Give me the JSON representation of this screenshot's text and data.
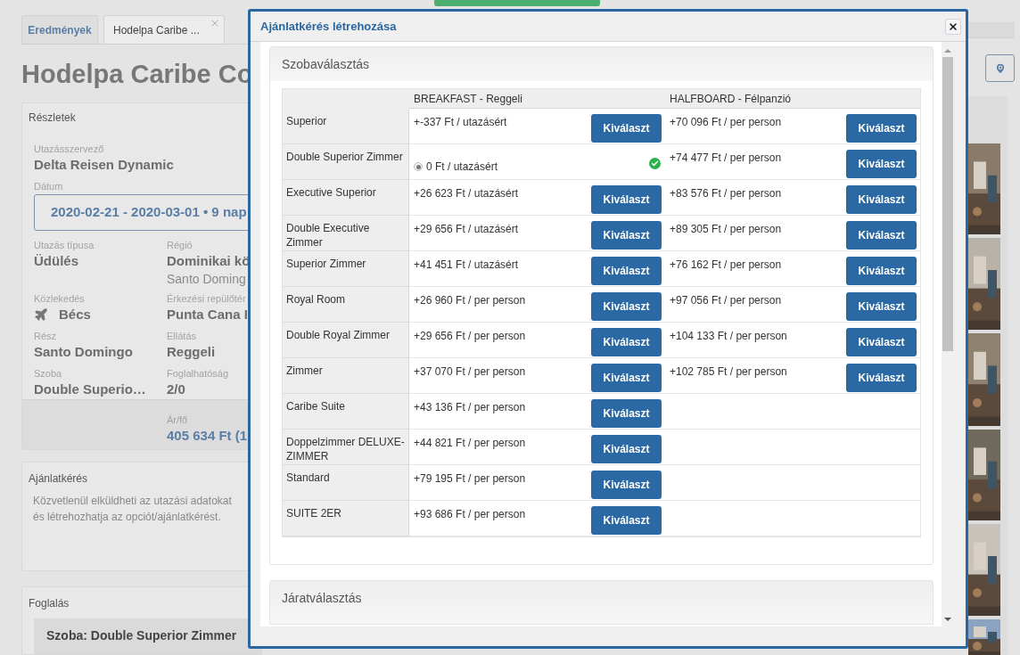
{
  "tabs": [
    {
      "label": "Eredmények",
      "selected": false
    },
    {
      "label": "Hodelpa Caribe ...",
      "selected": true
    }
  ],
  "page_title": "Hodelpa Caribe Co",
  "details": {
    "title": "Részletek",
    "fields": [
      {
        "kind": "plain",
        "label": "Utazásszervező",
        "value": "Delta Reisen Dynamic"
      },
      {
        "kind": "date",
        "label": "Dátum",
        "value": "2020-02-21 - 2020-03-01 • 9 nap"
      }
    ],
    "grid": [
      {
        "kind": "plain",
        "label": "Utazás típusa",
        "value": "Üdülés"
      },
      {
        "kind": "plain",
        "label": "Régió",
        "value": "Dominikai kö",
        "sub": "Santo Doming"
      },
      {
        "kind": "transport",
        "label": "Közlekedés",
        "value": "Bécs"
      },
      {
        "kind": "plain",
        "label": "Érkezési repülőtér",
        "value": "Punta Cana I"
      },
      {
        "kind": "plain",
        "label": "Rész",
        "value": "Santo Domingo"
      },
      {
        "kind": "plain",
        "label": "Ellátás",
        "value": "Reggeli"
      },
      {
        "kind": "plain",
        "label": "Szoba",
        "value": "Double Superio…"
      },
      {
        "kind": "plain",
        "label": "Foglalhatóság",
        "value": "2/0"
      }
    ],
    "price": {
      "label": "Ár/fő",
      "value": "405 634 Ft (1"
    }
  },
  "offer_request": {
    "title": "Ajánlatkérés",
    "lines": [
      "Közvetlenül elküldheti az utazási adatokat",
      "és létrehozhatja az opciót/ajánlatkérést."
    ]
  },
  "booking": {
    "title": "Foglalás",
    "room": "Szoba: Double Superior Zimmer"
  },
  "modal": {
    "title": "Ajánlatkérés létrehozása",
    "room_section": {
      "title": "Szobaválasztás",
      "columns": [
        "BREAKFAST - Reggeli",
        "HALFBOARD - Félpanzió"
      ],
      "rows": [
        {
          "name": "Superior",
          "cells": [
            {
              "kind": "offer",
              "price": "+-337 Ft / utazásért",
              "selected": false,
              "button": "Kiválaszt"
            },
            {
              "kind": "offer",
              "price": "+70 096 Ft / per person",
              "selected": false,
              "button": "Kiválaszt"
            }
          ]
        },
        {
          "name": "Double Superior Zimmer",
          "cells": [
            {
              "kind": "offer",
              "price": "0 Ft / utazásért",
              "selected": true
            },
            {
              "kind": "offer",
              "price": "+74 477 Ft / per person",
              "selected": false,
              "button": "Kiválaszt"
            }
          ]
        },
        {
          "name": "Executive Superior",
          "cells": [
            {
              "kind": "offer",
              "price": "+26 623 Ft / utazásért",
              "selected": false,
              "button": "Kiválaszt"
            },
            {
              "kind": "offer",
              "price": "+83 576 Ft / per person",
              "selected": false,
              "button": "Kiválaszt"
            }
          ]
        },
        {
          "name": "Double Executive Zimmer",
          "cells": [
            {
              "kind": "offer",
              "price": "+29 656 Ft / utazásért",
              "selected": false,
              "button": "Kiválaszt"
            },
            {
              "kind": "offer",
              "price": "+89 305 Ft / per person",
              "selected": false,
              "button": "Kiválaszt"
            }
          ]
        },
        {
          "name": "Superior Zimmer",
          "cells": [
            {
              "kind": "offer",
              "price": "+41 451 Ft / utazásért",
              "selected": false,
              "button": "Kiválaszt"
            },
            {
              "kind": "offer",
              "price": "+76 162 Ft / per person",
              "selected": false,
              "button": "Kiválaszt"
            }
          ]
        },
        {
          "name": "Royal Room",
          "cells": [
            {
              "kind": "offer",
              "price": "+26 960 Ft / per person",
              "selected": false,
              "button": "Kiválaszt"
            },
            {
              "kind": "offer",
              "price": "+97 056 Ft / per person",
              "selected": false,
              "button": "Kiválaszt"
            }
          ]
        },
        {
          "name": "Double Royal Zimmer",
          "cells": [
            {
              "kind": "offer",
              "price": "+29 656 Ft / per person",
              "selected": false,
              "button": "Kiválaszt"
            },
            {
              "kind": "offer",
              "price": "+104 133 Ft / per person",
              "selected": false,
              "button": "Kiválaszt"
            }
          ]
        },
        {
          "name": "Zimmer",
          "cells": [
            {
              "kind": "offer",
              "price": "+37 070 Ft / per person",
              "selected": false,
              "button": "Kiválaszt"
            },
            {
              "kind": "offer",
              "price": "+102 785 Ft / per person",
              "selected": false,
              "button": "Kiválaszt"
            }
          ]
        },
        {
          "name": "Caribe Suite",
          "cells": [
            {
              "kind": "offer",
              "price": "+43 136 Ft / per person",
              "selected": false,
              "button": "Kiválaszt"
            },
            {
              "kind": "empty"
            }
          ]
        },
        {
          "name": "Doppelzimmer DELUXE-ZIMMER",
          "cells": [
            {
              "kind": "offer",
              "price": "+44 821 Ft / per person",
              "selected": false,
              "button": "Kiválaszt"
            },
            {
              "kind": "empty"
            }
          ]
        },
        {
          "name": "Standard",
          "cells": [
            {
              "kind": "offer",
              "price": "+79 195 Ft / per person",
              "selected": false,
              "button": "Kiválaszt"
            },
            {
              "kind": "empty"
            }
          ]
        },
        {
          "name": "SUITE 2ER",
          "cells": [
            {
              "kind": "offer",
              "price": "+93 686 Ft / per person",
              "selected": false,
              "button": "Kiválaszt"
            },
            {
              "kind": "empty"
            }
          ]
        }
      ]
    },
    "flight_section": {
      "title": "Járatválasztás"
    }
  }
}
